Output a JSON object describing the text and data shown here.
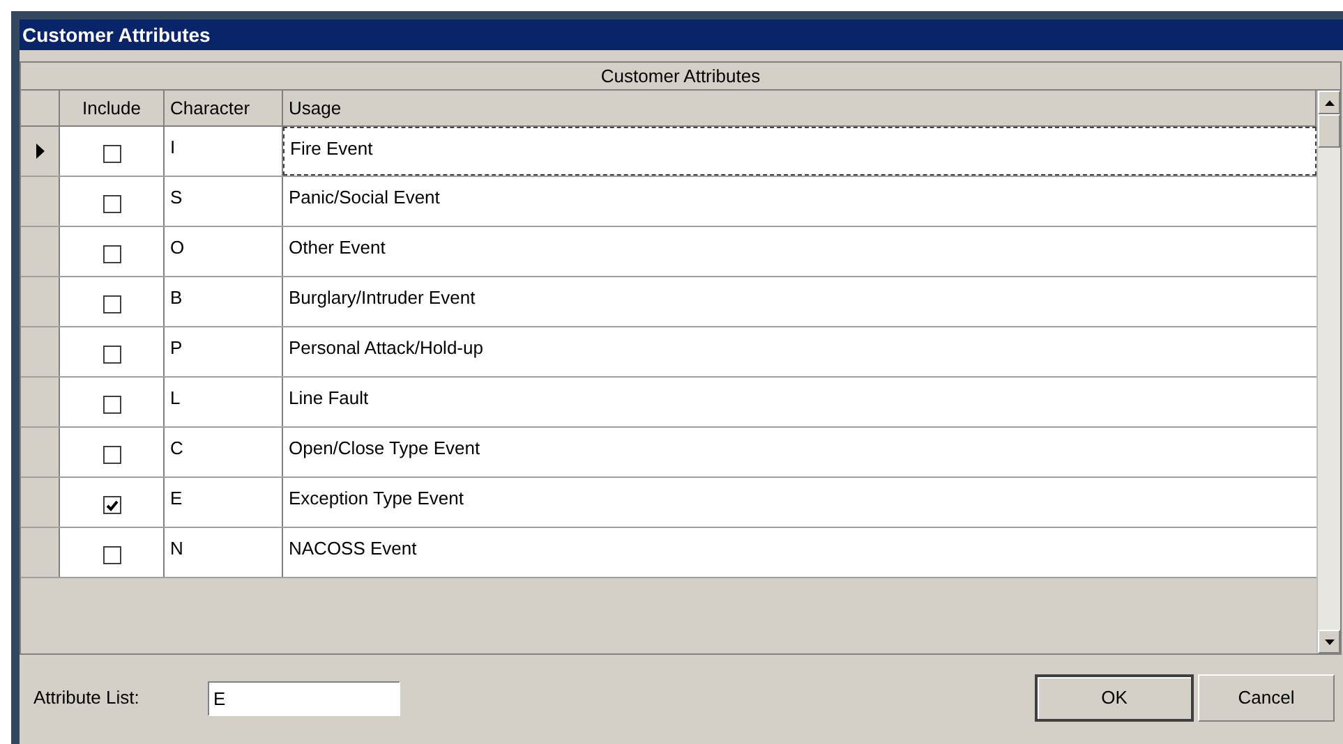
{
  "window": {
    "title": "Customer Attributes"
  },
  "grid": {
    "caption": "Customer Attributes",
    "columns": [
      "Include",
      "Character",
      "Usage"
    ],
    "rows": [
      {
        "include": false,
        "character": "I",
        "usage": "Fire Event",
        "selected": true
      },
      {
        "include": false,
        "character": "S",
        "usage": "Panic/Social Event",
        "selected": false
      },
      {
        "include": false,
        "character": "O",
        "usage": "Other Event",
        "selected": false
      },
      {
        "include": false,
        "character": "B",
        "usage": "Burglary/Intruder Event",
        "selected": false
      },
      {
        "include": false,
        "character": "P",
        "usage": "Personal Attack/Hold-up",
        "selected": false
      },
      {
        "include": false,
        "character": "L",
        "usage": "Line Fault",
        "selected": false
      },
      {
        "include": false,
        "character": "C",
        "usage": "Open/Close Type Event",
        "selected": false
      },
      {
        "include": true,
        "character": "E",
        "usage": "Exception Type Event",
        "selected": false
      },
      {
        "include": false,
        "character": "N",
        "usage": "NACOSS Event",
        "selected": false
      }
    ]
  },
  "attribute_list": {
    "label": "Attribute List:",
    "value": "E"
  },
  "buttons": [
    "OK",
    "Cancel"
  ]
}
